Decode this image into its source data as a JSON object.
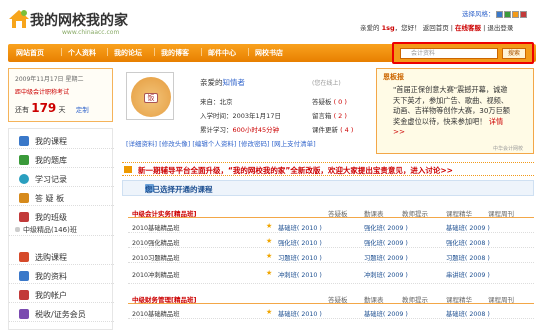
{
  "header": {
    "logo_text": "我的网校我的家",
    "logo_url": "www.chinaacc.com",
    "style_label": "选择风格：",
    "greeting": "亲爱的",
    "username": "1sg",
    "login_suffix": "，您好！",
    "previous_page": "返回首页",
    "online_service": "在线客服",
    "logout": "退出登录"
  },
  "nav": {
    "items": [
      "网站首页",
      "个人资料",
      "我的论坛",
      "我的博客",
      "邮件中心",
      "网校书店"
    ]
  },
  "search": {
    "placeholder": "会计资料",
    "button": "搜索"
  },
  "sidebar": {
    "date": "2009年11月17日 星期二",
    "countdown_title": "距中级会计职称考试",
    "countdown_prefix": "还有",
    "countdown_days": "179",
    "countdown_unit": "天",
    "countdown_link": "定制",
    "menu": [
      {
        "label": "我的课程",
        "color": "#3a78c9"
      },
      {
        "label": "我的题库",
        "color": "#3a9a3a"
      },
      {
        "label": "学习记录",
        "color": "#2a9fbf"
      },
      {
        "label": "答 疑 板",
        "color": "#d68a1c"
      },
      {
        "label": "我的班级",
        "color": "#c23a3a"
      },
      {
        "label": "中级精品(146)班",
        "color": "#999999"
      },
      {
        "label": "选购课程",
        "color": "#d64a2a"
      },
      {
        "label": "我的资料",
        "color": "#3a78c9"
      },
      {
        "label": "我的帐户",
        "color": "#c23a3a"
      },
      {
        "label": "税收/证务会员",
        "color": "#7a4ab0"
      }
    ]
  },
  "profile": {
    "greeting_prefix": "亲爱的",
    "name": "知情者",
    "online_status": "(您在线上)",
    "origin_label": "来自：",
    "origin": "北京",
    "join_label": "入学时间：",
    "join_date": "2003年1月17日",
    "study_label": "累计学习：",
    "study_time": "600小时45分钟",
    "answer_label": "答疑板",
    "answer_count": "( 0 )",
    "messages_label": "留言箱",
    "messages_count": "( 2 )",
    "system_label": "系统信息",
    "system_count": "( 0 )",
    "renew_label": "课件更新",
    "renew_count": "( 4 )",
    "avatar_char": "饭",
    "links": [
      "[详细资料]",
      "[修改头像]",
      "[编辑个人资料]",
      "[修改密码]",
      "[网上支付清单]"
    ]
  },
  "notice": {
    "title": "恩板报",
    "body": "\"首届正保创意大赛\"震撼开幕，诚邀天下英才，参加广告、歌曲、视频、动画、吉祥物等创作大赛，30万巨额奖金虚位以待，快来参加吧！",
    "link": "详情>>",
    "logo": "中华会计网校"
  },
  "banner": {
    "text": "新一期辅导平台全面升级，“我的网校我的家”全新改版，欢迎大家提出宝贵意见，进入讨论>>"
  },
  "courses": {
    "section_title": "您已选择开通的课程",
    "groups": [
      {
        "name": "中级会计实务[精品班]",
        "links": [
          "答疑板",
          "勤课表",
          "教师提示",
          "课程精华",
          "课程周刊"
        ],
        "rows": [
          {
            "course": "2010基础精品班",
            "star_label": "基础班",
            "year": "( 2010 )",
            "c2": "强化班",
            "y2": "( 2009 )",
            "c3": "基础班",
            "y3": "( 2009 )"
          },
          {
            "course": "2010强化精品班",
            "star_label": "强化班",
            "year": "( 2010 )",
            "c2": "强化班",
            "y2": "( 2009 )",
            "c3": "强化班",
            "y3": "( 2008 )"
          },
          {
            "course": "2010习题精品班",
            "star_label": "习题班",
            "year": "( 2010 )",
            "c2": "习题班",
            "y2": "( 2009 )",
            "c3": "习题班",
            "y3": "( 2008 )"
          },
          {
            "course": "2010冲刺精品班",
            "star_label": "冲刺班",
            "year": "( 2010 )",
            "c2": "冲刺班",
            "y2": "( 2009 )",
            "c3": "串讲班",
            "y3": "( 2009 )"
          }
        ]
      },
      {
        "name": "中级财务管理[精品班]",
        "links": [
          "答疑板",
          "勤课表",
          "教师提示",
          "课程精华",
          "课程周刊"
        ],
        "rows": [
          {
            "course": "2010基础精品班",
            "star_label": "基础班",
            "year": "( 2010 )",
            "c2": "基础班",
            "y2": "( 2009 )",
            "c3": "基础班",
            "y3": "( 2008 )"
          }
        ]
      }
    ]
  }
}
